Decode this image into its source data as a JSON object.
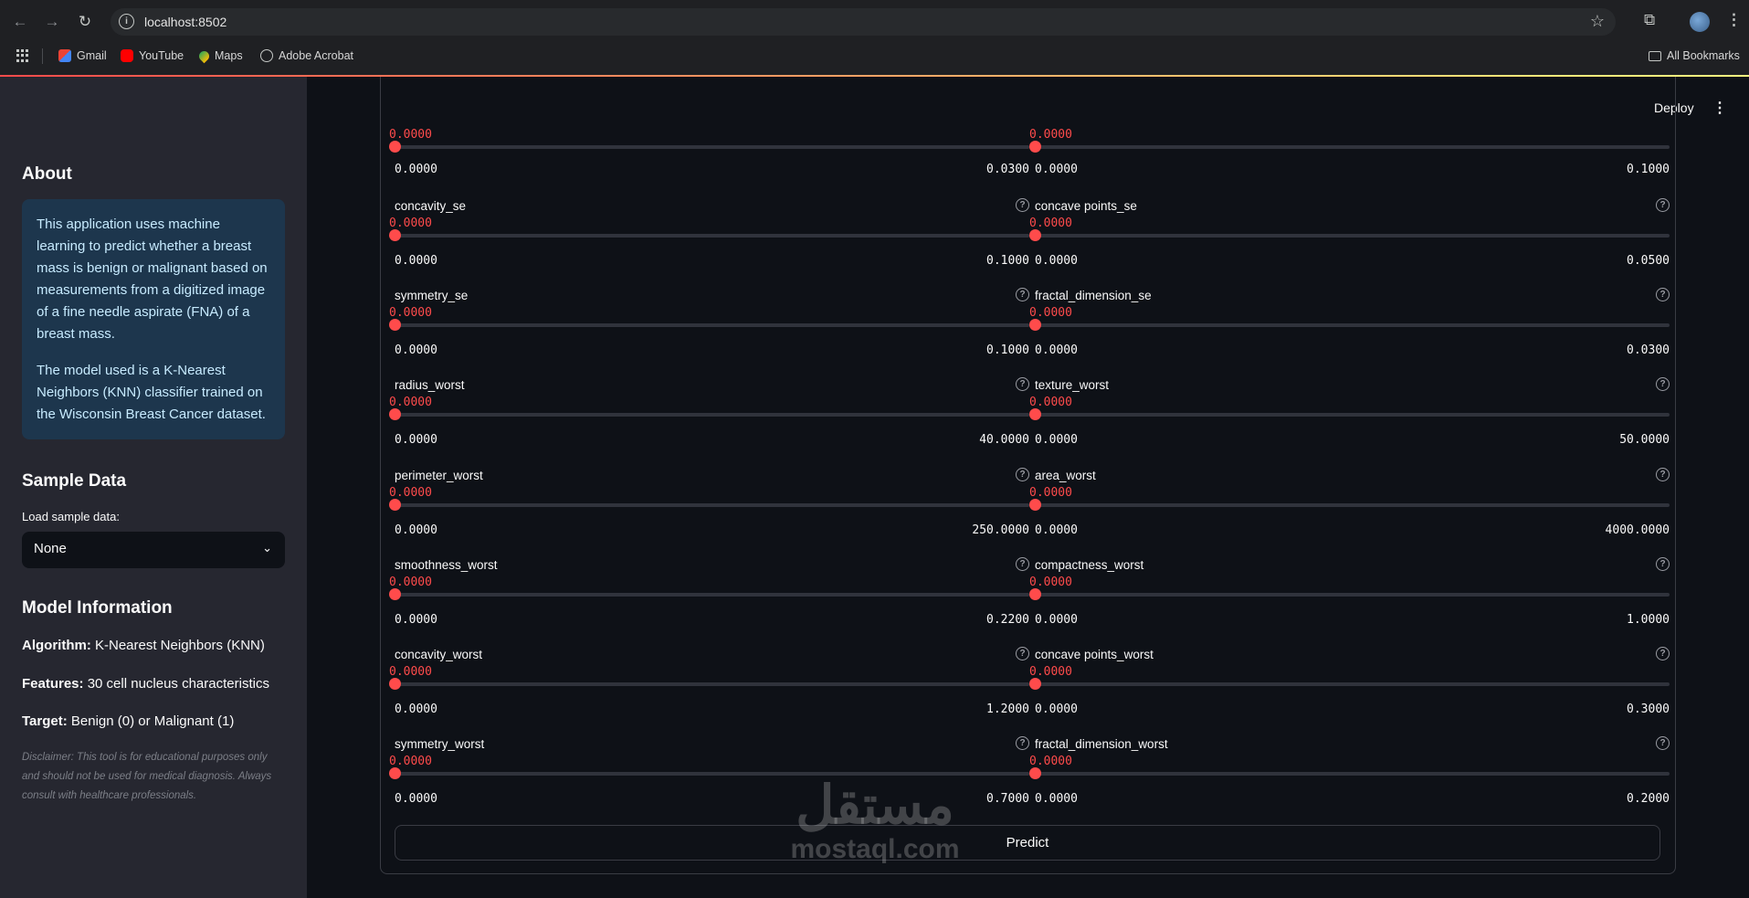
{
  "browser": {
    "url": "localhost:8502",
    "bookmarks": [
      "Gmail",
      "YouTube",
      "Maps",
      "Adobe Acrobat"
    ],
    "all_bookmarks": "All Bookmarks"
  },
  "sidebar": {
    "about_title": "About",
    "about_p1": "This application uses machine learning to predict whether a breast mass is benign or malignant based on measurements from a digitized image of a fine needle aspirate (FNA) of a breast mass.",
    "about_p2": "The model used is a K-Nearest Neighbors (KNN) classifier trained on the Wisconsin Breast Cancer dataset.",
    "sample_title": "Sample Data",
    "sample_label": "Load sample data:",
    "sample_selected": "None",
    "model_title": "Model Information",
    "algorithm_key": "Algorithm:",
    "algorithm_val": " K-Nearest Neighbors (KNN)",
    "features_key": "Features:",
    "features_val": " 30 cell nucleus characteristics",
    "target_key": "Target:",
    "target_val": " Benign (0) or Malignant (1)",
    "disclaimer": "Disclaimer: This tool is for educational purposes only and should not be used for medical diagnosis. Always consult with healthcare professionals."
  },
  "header": {
    "deploy": "Deploy",
    "menu": "⋮"
  },
  "sliders_top": [
    {
      "value": "0.0000",
      "min": "0.0000",
      "max": "0.0300"
    },
    {
      "value": "0.0000",
      "min": "0.0000",
      "max": "0.1000"
    }
  ],
  "sliders": [
    {
      "label": "concavity_se",
      "value": "0.0000",
      "min": "0.0000",
      "max": "0.1000"
    },
    {
      "label": "concave points_se",
      "value": "0.0000",
      "min": "0.0000",
      "max": "0.0500"
    },
    {
      "label": "symmetry_se",
      "value": "0.0000",
      "min": "0.0000",
      "max": "0.1000"
    },
    {
      "label": "fractal_dimension_se",
      "value": "0.0000",
      "min": "0.0000",
      "max": "0.0300"
    },
    {
      "label": "radius_worst",
      "value": "0.0000",
      "min": "0.0000",
      "max": "40.0000"
    },
    {
      "label": "texture_worst",
      "value": "0.0000",
      "min": "0.0000",
      "max": "50.0000"
    },
    {
      "label": "perimeter_worst",
      "value": "0.0000",
      "min": "0.0000",
      "max": "250.0000"
    },
    {
      "label": "area_worst",
      "value": "0.0000",
      "min": "0.0000",
      "max": "4000.0000"
    },
    {
      "label": "smoothness_worst",
      "value": "0.0000",
      "min": "0.0000",
      "max": "0.2200"
    },
    {
      "label": "compactness_worst",
      "value": "0.0000",
      "min": "0.0000",
      "max": "1.0000"
    },
    {
      "label": "concavity_worst",
      "value": "0.0000",
      "min": "0.0000",
      "max": "1.2000"
    },
    {
      "label": "concave points_worst",
      "value": "0.0000",
      "min": "0.0000",
      "max": "0.3000"
    },
    {
      "label": "symmetry_worst",
      "value": "0.0000",
      "min": "0.0000",
      "max": "0.7000"
    },
    {
      "label": "fractal_dimension_worst",
      "value": "0.0000",
      "min": "0.0000",
      "max": "0.2000"
    }
  ],
  "predict_label": "Predict",
  "watermark": {
    "arabic": "مستقل",
    "latin": "mostaql.com"
  }
}
